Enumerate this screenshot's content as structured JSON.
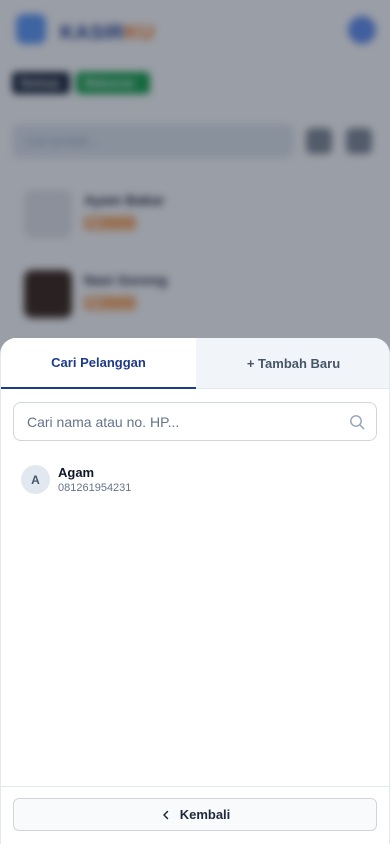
{
  "background": {
    "brand_main": "KASIR",
    "brand_accent": "KU",
    "filter_all": "Semua",
    "filter_active": "Makanan",
    "search_placeholder": "Cari produk...",
    "products": [
      {
        "name": "Ayam Bakar",
        "price": "Rp 15.000"
      },
      {
        "name": "Nasi Goreng",
        "price": "Rp 12.000"
      }
    ]
  },
  "sheet": {
    "tabs": [
      {
        "label": "Cari Pelanggan",
        "active": true
      },
      {
        "label": "+ Tambah Baru",
        "active": false
      }
    ],
    "search": {
      "placeholder": "Cari nama atau no. HP...",
      "value": ""
    },
    "customers": [
      {
        "initial": "A",
        "name": "Agam",
        "phone": "081261954231"
      }
    ],
    "back_label": "Kembali"
  },
  "colors": {
    "primary": "#1e3a8a",
    "accent": "#f97316",
    "success": "#16a34a"
  },
  "icons": {
    "search": "search-icon",
    "back": "chevron-left-icon"
  }
}
